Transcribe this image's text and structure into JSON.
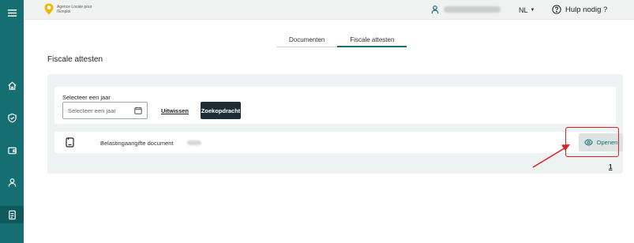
{
  "sidebar": {
    "items": [
      {
        "icon": "home-icon"
      },
      {
        "icon": "shield-check-icon"
      },
      {
        "icon": "wallet-icon"
      },
      {
        "icon": "user-icon"
      },
      {
        "icon": "tax-document-icon",
        "active": true
      }
    ]
  },
  "header": {
    "logo_text": "Agence Locale pour l'Emploi",
    "language": "NL",
    "help_label": "Hulp nodig ?"
  },
  "tabs": [
    {
      "label": "Documenten",
      "active": false
    },
    {
      "label": "Fiscale attesten",
      "active": true
    }
  ],
  "page": {
    "title": "Fiscale attesten"
  },
  "filter": {
    "label": "Selecteer een jaar",
    "placeholder": "Selecteer een jaar",
    "clear_label": "Uitwissen",
    "search_label": "Zoekopdracht"
  },
  "documents": [
    {
      "name": "Belastingaangifte document",
      "open_label": "Openen"
    }
  ],
  "pagination": {
    "current_page": "1"
  },
  "colors": {
    "accent": "#156f72",
    "sidebar": "#156f72",
    "dark_button": "#1d2e37",
    "highlight": "#e02020"
  }
}
